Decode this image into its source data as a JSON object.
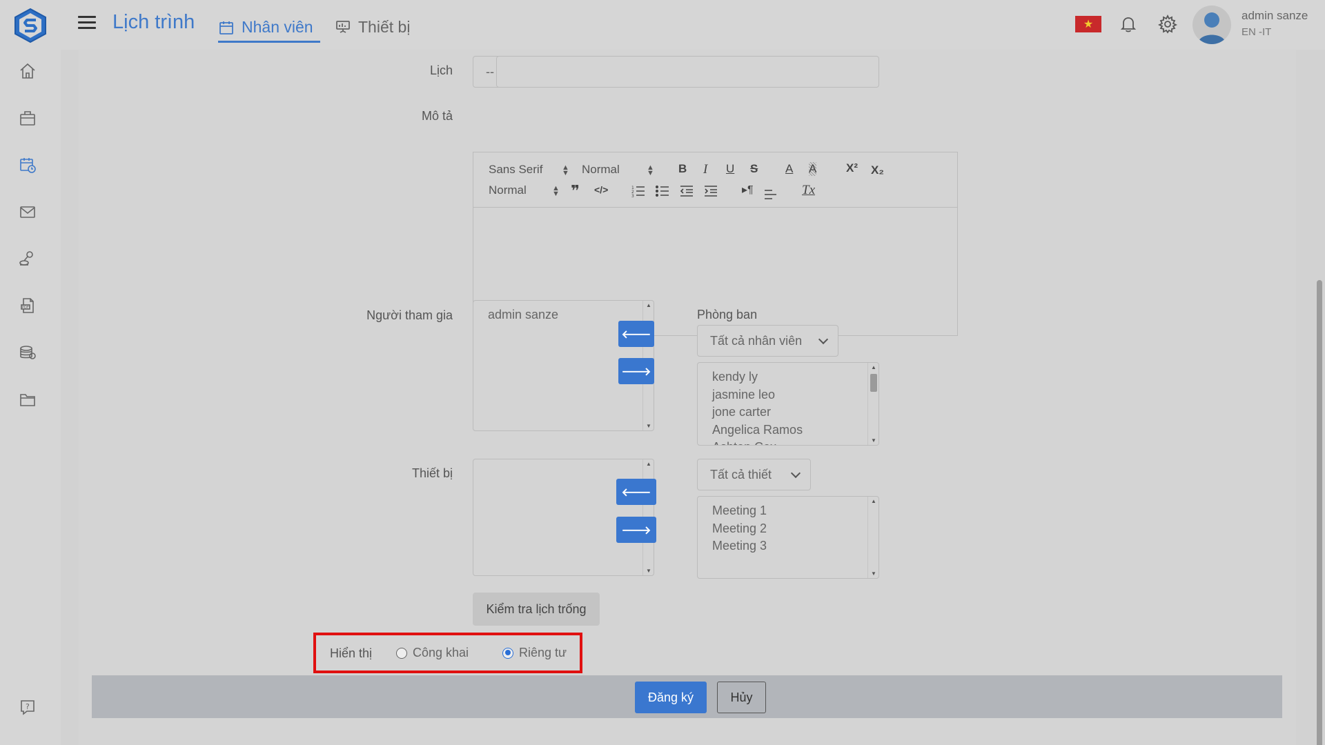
{
  "header": {
    "app_title": "Lịch trình",
    "tabs": [
      {
        "label": "Nhân viên",
        "active": true
      },
      {
        "label": "Thiết bị",
        "active": false
      }
    ],
    "user": {
      "name": "admin sanze",
      "dept": "EN -IT"
    }
  },
  "sidebar": {
    "icons": [
      "home-icon",
      "briefcase-icon",
      "calendar-clock-icon",
      "mail-icon",
      "stamp-icon",
      "pdf-document-icon",
      "coins-icon",
      "folder-icon",
      "help-icon"
    ]
  },
  "form": {
    "calendar": {
      "label": "Lịch",
      "selected": "--",
      "text": ""
    },
    "description": {
      "label": "Mô tả",
      "font": "Sans Serif",
      "size": "Normal",
      "heading": "Normal"
    },
    "participants": {
      "label": "Người tham gia",
      "selected": [
        "admin sanze"
      ],
      "department_label": "Phòng ban",
      "department_selected": "Tất cả nhân viên",
      "available": [
        "kendy ly",
        "jasmine leo",
        "jone carter",
        "Angelica Ramos",
        "Ashton Cox"
      ]
    },
    "devices": {
      "label": "Thiết bị",
      "selected": [],
      "filter_selected": "Tất cả thiết",
      "available": [
        "Meeting 1",
        "Meeting 2",
        "Meeting 3"
      ]
    },
    "check_button": "Kiểm tra lịch trống",
    "visibility": {
      "label": "Hiển thị",
      "options": [
        {
          "label": "Công khai",
          "checked": false
        },
        {
          "label": "Riêng tư",
          "checked": true
        }
      ]
    },
    "submit_label": "Đăng ký",
    "cancel_label": "Hủy"
  },
  "colors": {
    "accent": "#3a77cf",
    "highlight": "#e01010",
    "flag": "#c8292b"
  }
}
